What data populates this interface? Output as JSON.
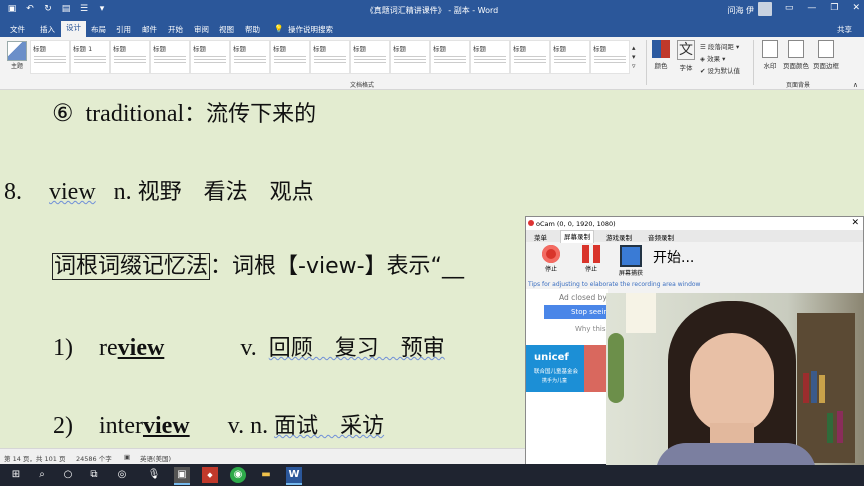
{
  "titlebar": {
    "doc_title": "《真题词汇精讲课件》 - 副本 - Word",
    "user": "问海 伊"
  },
  "tabs": {
    "items": [
      "文件",
      "插入",
      "设计",
      "布局",
      "引用",
      "邮件",
      "开始",
      "审阅",
      "视图",
      "帮助"
    ],
    "tell_me": "操作说明搜索",
    "share": "共享"
  },
  "ribbon": {
    "theme_label": "主题",
    "style_boxes": [
      "标题",
      "标题 1",
      "标题",
      "标题",
      "标题",
      "标题",
      "标题",
      "标题",
      "标题",
      "标题",
      "标题",
      "标题",
      "标题",
      "标题",
      "标题"
    ],
    "group_label": "文档格式",
    "colors_label": "颜色",
    "fonts_label": "字体",
    "paragraph_spacing": "段落间距",
    "effects": "效果",
    "set_default": "设为默认值",
    "watermark": "水印",
    "page_color": "页面颜色",
    "page_borders": "页面边框",
    "background_group": "页面背景"
  },
  "document": {
    "line1_num": "⑥",
    "line1_word": "traditional",
    "line1_cn": "：流传下来的",
    "line2_num": "8.",
    "line2_word": "view",
    "line2_pos": "n.",
    "line2_cn": "视野　看法　观点",
    "line3_boxed": "词根词缀记忆法",
    "line3_rest": "：词根【-view-】表示“__",
    "line4_num": "1)",
    "line4_prefix": "re",
    "line4_root": "view",
    "line4_pos": "v.",
    "line4_cn": "回顾　复习　预审",
    "line5_num": "2)",
    "line5_prefix": "inter",
    "line5_root": "view",
    "line5_pos": "v. n.",
    "line5_cn": "面试　采访"
  },
  "status": {
    "page": "第 14 页，共 101 页",
    "words": "24586 个字",
    "language": "英语(美国)"
  },
  "ocam": {
    "title": "oCam (0, 0, 1920, 1080)",
    "tabs": [
      "菜单",
      "屏幕录制",
      "游戏录制",
      "音频录制"
    ],
    "btn_stop1": "停止",
    "btn_stop2": "停止",
    "btn_capture": "屏幕捕获",
    "start_text": "开始...",
    "tip": "Tips for adjusting to elaborate the recording area window",
    "ad_closed": "Ad closed by",
    "stop_seeing": "Stop seein",
    "why_this": "Why this",
    "unicef_name": "unicef",
    "unicef_sub": "联合国儿童基金会",
    "unicef_sub2": "携手为儿童"
  }
}
